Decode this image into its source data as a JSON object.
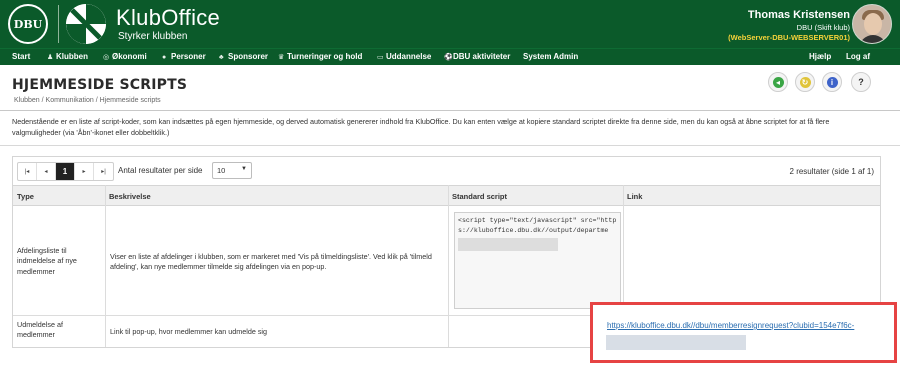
{
  "header": {
    "dbu_logo_text": "DBU",
    "brand_name": "KlubOffice",
    "brand_tagline": "Styrker klubben",
    "user_name": "Thomas Kristensen",
    "user_club": "DBU (Skift klub)",
    "server": "(WebServer-DBU-WEBSERVER01)"
  },
  "nav": {
    "items": [
      {
        "label": "Start",
        "icon": ""
      },
      {
        "label": "Klubben",
        "icon": "people-icon"
      },
      {
        "label": "Økonomi",
        "icon": "coin-icon"
      },
      {
        "label": "Personer",
        "icon": "person-icon"
      },
      {
        "label": "Sponsorer",
        "icon": "handshake-icon"
      },
      {
        "label": "Turneringer og hold",
        "icon": "trophy-icon"
      },
      {
        "label": "Uddannelse",
        "icon": "screen-icon"
      },
      {
        "label": "DBU aktiviteter",
        "icon": "ball-icon"
      },
      {
        "label": "System Admin",
        "icon": ""
      }
    ],
    "help": "Hjælp",
    "logout": "Log af"
  },
  "page": {
    "title": "HJEMMESIDE SCRIPTS",
    "breadcrumb": "Klubben / Kommunikation / Hjemmeside scripts",
    "intro": "Nedenstående er en liste af script-koder, som kan indsættes på egen hjemmeside, og derved automatisk genererer indhold fra KlubOffice. Du kan enten vælge at kopiere standard scriptet direkte fra denne side, men du kan også at åbne scriptet for at få flere valgmuligheder (via 'Åbn'-ikonet eller dobbeltklik.)"
  },
  "grid": {
    "pager": {
      "first": "|◂",
      "prev": "◂",
      "current": "1",
      "next": "▸",
      "last": "▸|"
    },
    "per_page_label": "Antal resultater per side",
    "per_page_value": "10",
    "result_info": "2 resultater (side 1 af 1)",
    "columns": [
      "Type",
      "Beskrivelse",
      "Standard script",
      "Link"
    ],
    "rows": [
      {
        "type": "Afdelingsliste til indmeldelse af nye medlemmer",
        "description": "Viser en liste af afdelinger i klubben, som er markeret med 'Vis på tilmeldingsliste'. Ved klik på 'tilmeld afdeling', kan nye medlemmer tilmelde sig afdelingen via en pop-up.",
        "script": "<script type=\"text/javascript\" src=\"https://kluboffice.dbu.dk//output/departme",
        "link": ""
      },
      {
        "type": "Udmeldelse af medlemmer",
        "description": "Link til pop-up, hvor medlemmer kan udmelde sig",
        "script": "",
        "link": "https://kluboffice.dbu.dk//dbu/memberresignrequest?clubid=154e7f6c-"
      }
    ]
  },
  "colors": {
    "brand_green": "#0b5a2a",
    "highlight_red": "#e64343",
    "link_blue": "#2a6db0",
    "server_yellow": "#f5d23a"
  }
}
